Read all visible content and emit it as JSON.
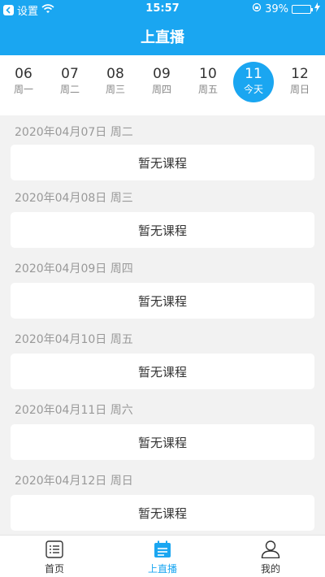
{
  "status_bar": {
    "back_label": "设置",
    "time": "15:57",
    "battery": "39%",
    "battery_level": 0.39
  },
  "header": {
    "title": "上直播"
  },
  "week": [
    {
      "num": "06",
      "label": "周一"
    },
    {
      "num": "07",
      "label": "周二"
    },
    {
      "num": "08",
      "label": "周三"
    },
    {
      "num": "09",
      "label": "周四"
    },
    {
      "num": "10",
      "label": "周五"
    },
    {
      "num": "11",
      "label": "今天",
      "selected": true
    },
    {
      "num": "12",
      "label": "周日"
    }
  ],
  "days": [
    {
      "date": "2020年04月07日  周二",
      "content": "暂无课程"
    },
    {
      "date": "2020年04月08日  周三",
      "content": "暂无课程"
    },
    {
      "date": "2020年04月09日  周四",
      "content": "暂无课程"
    },
    {
      "date": "2020年04月10日  周五",
      "content": "暂无课程"
    },
    {
      "date": "2020年04月11日  周六",
      "content": "暂无课程"
    },
    {
      "date": "2020年04月12日  周日",
      "content": "暂无课程"
    }
  ],
  "tab_bar": {
    "home": "首页",
    "live": "上直播",
    "mine": "我的"
  },
  "colors": {
    "accent": "#1aa6f1",
    "battery": "#7be34f"
  }
}
